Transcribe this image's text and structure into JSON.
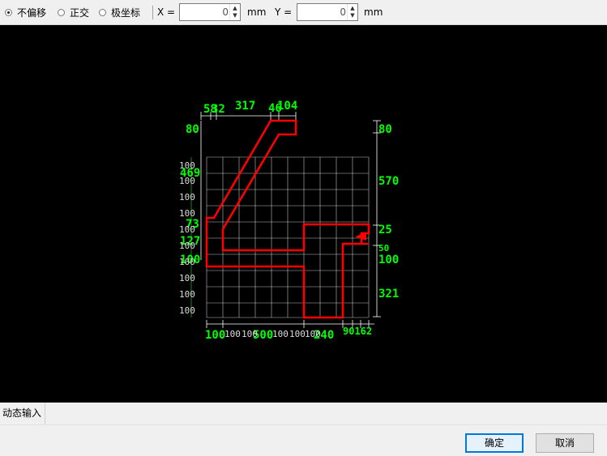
{
  "toolbar": {
    "options": [
      {
        "label": "不偏移",
        "selected": true
      },
      {
        "label": "正交",
        "selected": false
      },
      {
        "label": "极坐标",
        "selected": false
      }
    ],
    "x_label": "X =",
    "x_value": "0",
    "y_label": "Y =",
    "y_value": "0",
    "unit": "mm"
  },
  "drawing": {
    "colors": {
      "background": "#000000",
      "shape": "#ff0000",
      "grid": "#ffffff",
      "dim_text": "#00ff00"
    },
    "top_dims": [
      "58",
      "32",
      "317",
      "46",
      "104"
    ],
    "left_dims": [
      "80",
      "469",
      "73",
      "127",
      "100"
    ],
    "right_dims": [
      "80",
      "570",
      "25",
      "100",
      "321",
      "50"
    ],
    "row_scale": [
      "100",
      "100",
      "100",
      "100",
      "100",
      "100",
      "100",
      "100",
      "100",
      "100"
    ],
    "bottom_dims": [
      "100",
      "500",
      "240",
      "100"
    ],
    "bottom_tail": "90162"
  },
  "status": {
    "dynamic_input": "动态输入"
  },
  "buttons": {
    "ok": "确定",
    "cancel": "取消"
  }
}
